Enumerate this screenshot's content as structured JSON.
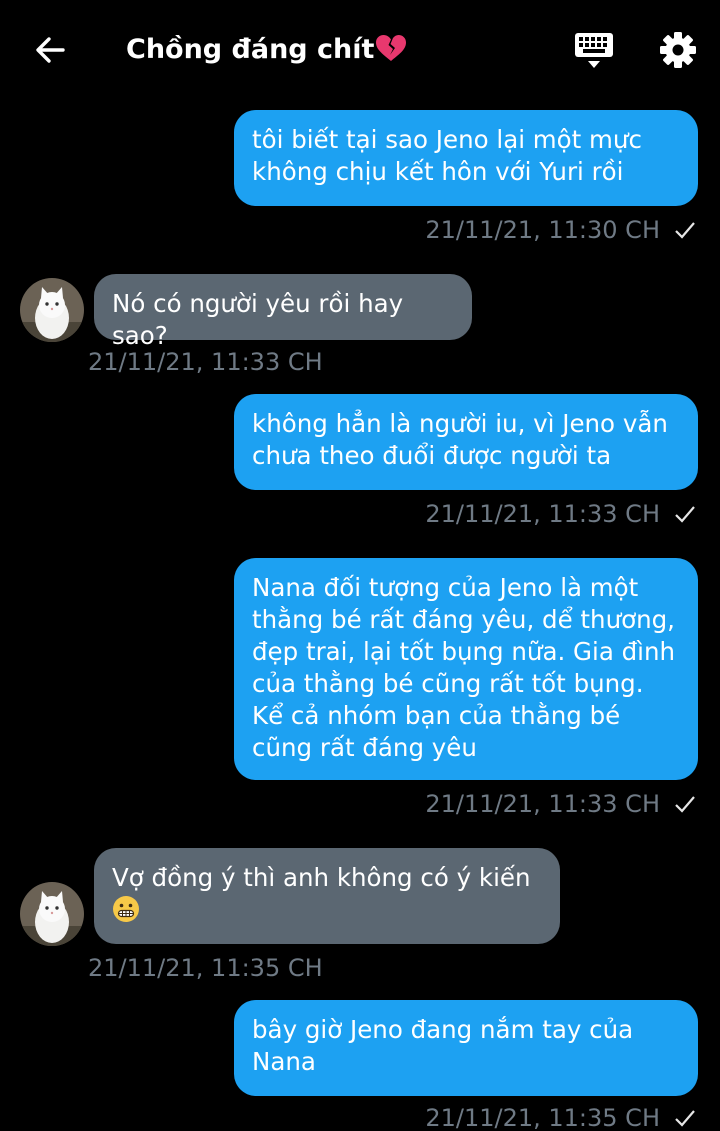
{
  "header": {
    "title": "Chồng đáng chít",
    "back_icon": "arrow-left-icon",
    "title_emoji": "broken-heart-icon",
    "keyboard_icon": "keyboard-icon",
    "settings_icon": "gear-icon"
  },
  "colors": {
    "outgoing_bubble": "#1da1f2",
    "incoming_bubble": "#5b6772",
    "timestamp": "#6f7a85",
    "background": "#000000"
  },
  "messages": [
    {
      "direction": "outgoing",
      "text": "tôi biết tại sao Jeno lại một mực không chịu kết hôn với Yuri rồi",
      "time": "21/11/21, 11:30 CH",
      "status": "sent-check"
    },
    {
      "direction": "incoming",
      "text": "Nó có người yêu rồi hay sao?",
      "time": "21/11/21, 11:33 CH"
    },
    {
      "direction": "outgoing",
      "text": "không hẳn là người iu, vì Jeno vẫn chưa theo đuổi được người ta",
      "time": "21/11/21, 11:33 CH",
      "status": "sent-check"
    },
    {
      "direction": "outgoing",
      "text": "Nana đối tượng của Jeno là một thằng bé rất đáng yêu, dể thương, đẹp trai, lại tốt bụng nữa. Gia đình của thằng bé cũng rất tốt bụng. Kể cả nhóm bạn của thằng bé cũng rất đáng yêu",
      "time": "21/11/21, 11:33 CH",
      "status": "sent-check"
    },
    {
      "direction": "incoming",
      "text": "Vợ đồng ý thì anh không có ý kiến",
      "emoji": "grimacing-face-icon",
      "time": "21/11/21, 11:35 CH"
    },
    {
      "direction": "outgoing",
      "text": "bây giờ Jeno đang nắm tay của Nana",
      "time": "21/11/21, 11:35 CH",
      "status": "sent-check"
    }
  ]
}
